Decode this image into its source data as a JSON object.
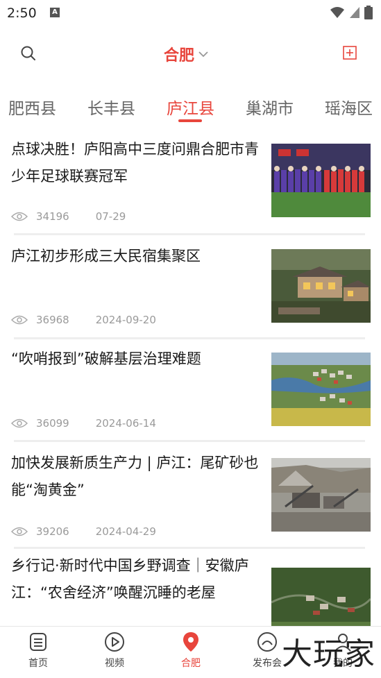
{
  "status_bar": {
    "time": "2:50",
    "notification_glyph": "A"
  },
  "header": {
    "city": "合肥",
    "colors": {
      "accent": "#e8453c"
    }
  },
  "tabs": [
    {
      "label": "肥西县",
      "active": false
    },
    {
      "label": "长丰县",
      "active": false
    },
    {
      "label": "庐江县",
      "active": true
    },
    {
      "label": "巢湖市",
      "active": false
    },
    {
      "label": "瑶海区",
      "active": false
    }
  ],
  "news": [
    {
      "title": "点球决胜！庐阳高中三度问鼎合肥市青少年足球联赛冠军",
      "views": "34196",
      "date": "07-29",
      "image": "football-team-photo"
    },
    {
      "title": "庐江初步形成三大民宿集聚区",
      "views": "36968",
      "date": "2024-09-20",
      "image": "homestay-buildings-photo"
    },
    {
      "title": "“吹哨报到”破解基层治理难题",
      "views": "36099",
      "date": "2024-06-14",
      "image": "village-aerial-photo"
    },
    {
      "title": "加快发展新质生产力 | 庐江：尾矿砂也能“淘黄金”",
      "views": "39206",
      "date": "2024-04-29",
      "image": "quarry-machinery-photo"
    },
    {
      "title": "乡行记·新时代中国乡野调查｜安徽庐江：“农舍经济”唤醒沉睡的老屋",
      "views": "",
      "date": "",
      "image": "countryside-aerial-photo"
    }
  ],
  "bottom_nav": [
    {
      "label": "首页",
      "icon": "home-doc-icon"
    },
    {
      "label": "视频",
      "icon": "play-circle-icon"
    },
    {
      "label": "合肥",
      "icon": "location-pin-icon",
      "active": true
    },
    {
      "label": "发布会",
      "icon": "press-conference-icon"
    },
    {
      "label": "我的",
      "icon": "user-icon"
    }
  ],
  "watermark": "大玩家"
}
